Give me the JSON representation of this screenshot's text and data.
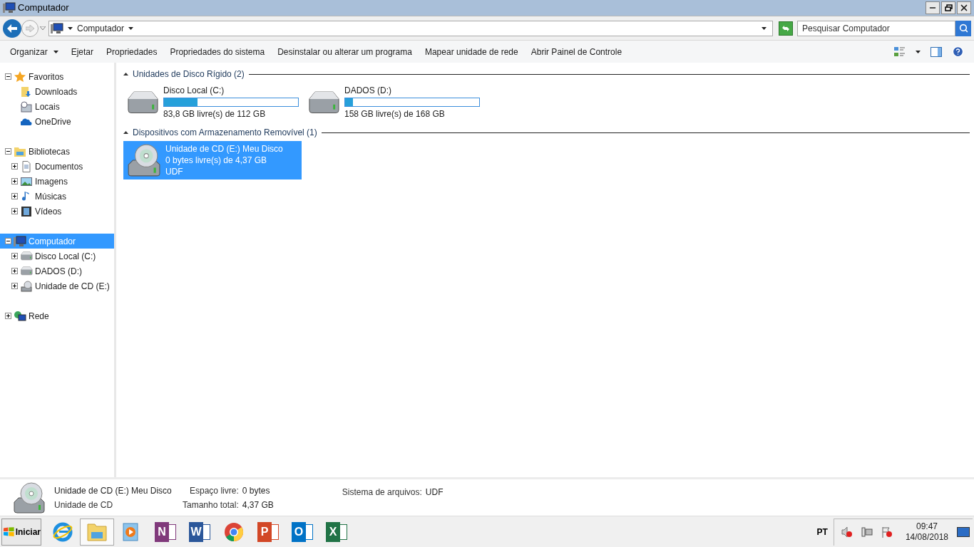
{
  "window": {
    "title": "Computador"
  },
  "address": {
    "crumbs": [
      "Computador"
    ]
  },
  "search": {
    "placeholder": "Pesquisar Computador"
  },
  "toolbar": [
    {
      "label": "Organizar",
      "dropdown": true
    },
    {
      "label": "Ejetar",
      "dropdown": false
    },
    {
      "label": "Propriedades",
      "dropdown": false
    },
    {
      "label": "Propriedades do sistema",
      "dropdown": false
    },
    {
      "label": "Desinstalar ou alterar um programa",
      "dropdown": false
    },
    {
      "label": "Mapear unidade de rede",
      "dropdown": false
    },
    {
      "label": "Abrir Painel de Controle",
      "dropdown": false
    }
  ],
  "sidebar": [
    {
      "label": "Favoritos",
      "expanded": true,
      "selected": false,
      "children": [
        {
          "label": "Downloads",
          "selected": false
        },
        {
          "label": "Locais",
          "selected": false
        },
        {
          "label": "OneDrive",
          "selected": false
        }
      ]
    },
    {
      "label": "Bibliotecas",
      "expanded": true,
      "selected": false,
      "children": [
        {
          "label": "Documentos",
          "expanded": false,
          "selected": false
        },
        {
          "label": "Imagens",
          "expanded": false,
          "selected": false
        },
        {
          "label": "Músicas",
          "expanded": false,
          "selected": false
        },
        {
          "label": "Vídeos",
          "expanded": false,
          "selected": false
        }
      ]
    },
    {
      "label": "Computador",
      "expanded": true,
      "selected": true,
      "children": [
        {
          "label": "Disco Local (C:)",
          "expanded": false,
          "selected": false
        },
        {
          "label": "DADOS (D:)",
          "expanded": false,
          "selected": false
        },
        {
          "label": "Unidade de CD (E:)",
          "expanded": false,
          "selected": false
        }
      ]
    },
    {
      "label": "Rede",
      "expanded": false,
      "selected": false
    }
  ],
  "sections": [
    {
      "title": "Unidades de Disco Rígido (2)",
      "expanded": true,
      "items": [
        {
          "kind": "hdd",
          "name": "Disco Local (C:)",
          "level": 0.25,
          "free": "83,8 GB livre(s) de 112 GB",
          "selected": false
        },
        {
          "kind": "hdd",
          "name": "DADOS (D:)",
          "level": 0.06,
          "free": "158 GB livre(s) de 168 GB",
          "selected": false
        }
      ]
    },
    {
      "title": "Dispositivos com Armazenamento Removível (1)",
      "expanded": true,
      "items": [
        {
          "kind": "cd",
          "lines": [
            "Unidade de CD (E:) Meu Disco",
            "0 bytes livre(s) de 4,37 GB",
            "UDF"
          ],
          "selected": true
        }
      ]
    }
  ],
  "details": {
    "name": "Unidade de CD (E:) Meu Disco",
    "type": "Unidade de CD",
    "fields": [
      {
        "label": "Espaço livre:",
        "value": "0 bytes"
      },
      {
        "label": "Tamanho total:",
        "value": "4,37 GB"
      },
      {
        "label": "Sistema de arquivos:",
        "value": "UDF"
      }
    ]
  },
  "taskbar": {
    "start": "Iniciar",
    "apps": [
      {
        "kind": "ie",
        "selected": false
      },
      {
        "kind": "explorer",
        "selected": true
      },
      {
        "kind": "media",
        "selected": false
      },
      {
        "kind": "office",
        "glyph": "N",
        "color": "#80397b",
        "selected": false
      },
      {
        "kind": "office",
        "glyph": "W",
        "color": "#2b579a",
        "selected": false
      },
      {
        "kind": "chrome",
        "selected": false
      },
      {
        "kind": "office",
        "glyph": "P",
        "color": "#d24726",
        "selected": false
      },
      {
        "kind": "office",
        "glyph": "O",
        "color": "#0072c6",
        "selected": false
      },
      {
        "kind": "office",
        "glyph": "X",
        "color": "#217346",
        "selected": false
      }
    ],
    "language": "PT",
    "time": "09:47",
    "date": "14/08/2018"
  }
}
